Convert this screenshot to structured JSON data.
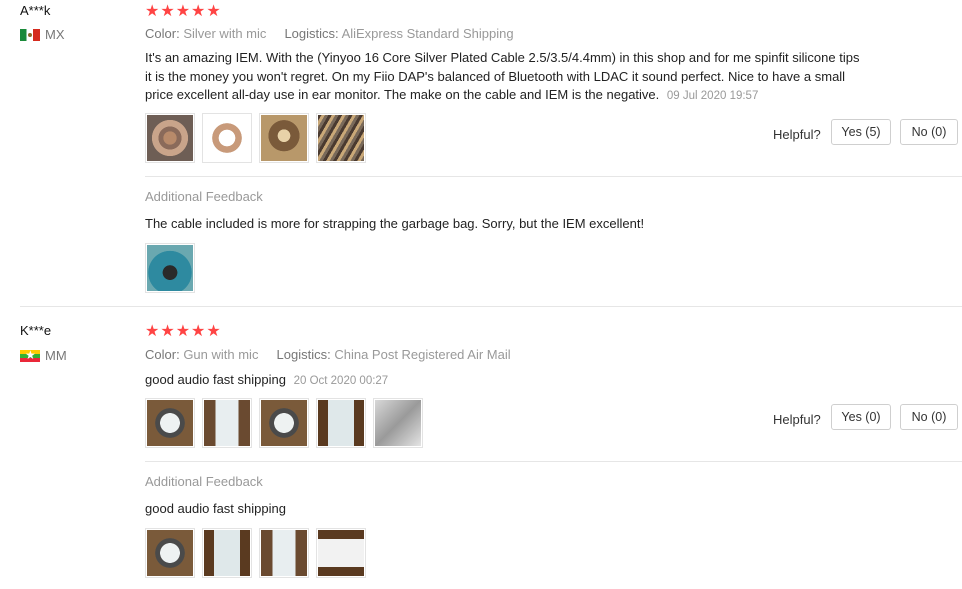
{
  "reviews": [
    {
      "user": "A***k",
      "country": "MX",
      "stars": "★★★★★",
      "color_label": "Color:",
      "color_value": "Silver with mic",
      "logistics_label": "Logistics:",
      "logistics_value": "AliExpress Standard Shipping",
      "text": "It's an amazing IEM. With the (Yinyoo 16 Core Silver Plated Cable 2.5/3.5/4.4mm) in this shop and for me spinfit silicone tips it is the money you won't regret. On my Fiio DAP's balanced of Bluetooth with LDAC it sound perfect. Nice to have a small price excellent all-day use in ear monitor. The make on the cable and IEM is the negative.",
      "date": "09 Jul 2020 19:57",
      "helpful_label": "Helpful?",
      "yes_label": "Yes (5)",
      "no_label": "No (0)",
      "additional_title": "Additional Feedback",
      "additional_text": "The cable included is more for strapping the garbage bag. Sorry, but the IEM excellent!"
    },
    {
      "user": "K***e",
      "country": "MM",
      "stars": "★★★★★",
      "color_label": "Color:",
      "color_value": "Gun with mic",
      "logistics_label": "Logistics:",
      "logistics_value": "China Post Registered Air Mail",
      "text": "good audio fast shipping",
      "date": "20 Oct 2020 00:27",
      "helpful_label": "Helpful?",
      "yes_label": "Yes (0)",
      "no_label": "No (0)",
      "additional_title": "Additional Feedback",
      "additional_text": "good audio fast shipping"
    }
  ],
  "colors": {
    "star": "#ff4444",
    "muted": "#999999",
    "border": "#cfcfcf"
  }
}
